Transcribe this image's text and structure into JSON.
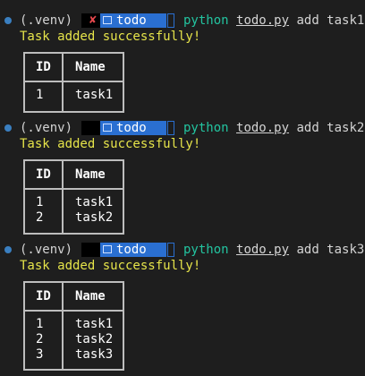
{
  "blocks": [
    {
      "venv": "(.venv)",
      "status_icon": "cross-mark-icon",
      "directory": "todo",
      "command": {
        "keyword": "python",
        "file": "todo.py",
        "args": "add task1"
      },
      "message": "Task added successfully!",
      "table": {
        "headers": [
          "ID",
          "Name"
        ],
        "rows": [
          [
            "1",
            "task1"
          ]
        ]
      }
    },
    {
      "venv": "(.venv)",
      "status_icon": "",
      "directory": "todo",
      "command": {
        "keyword": "python",
        "file": "todo.py",
        "args": "add task2"
      },
      "message": "Task added successfully!",
      "table": {
        "headers": [
          "ID",
          "Name"
        ],
        "rows": [
          [
            "1",
            "task1"
          ],
          [
            "2",
            "task2"
          ]
        ]
      }
    },
    {
      "venv": "(.venv)",
      "status_icon": "",
      "directory": "todo",
      "command": {
        "keyword": "python",
        "file": "todo.py",
        "args": "add task3"
      },
      "message": "Task added successfully!",
      "table": {
        "headers": [
          "ID",
          "Name"
        ],
        "rows": [
          [
            "1",
            "task1"
          ],
          [
            "2",
            "task2"
          ],
          [
            "3",
            "task3"
          ]
        ]
      }
    }
  ],
  "colors": {
    "background": "#1e1e1e",
    "prompt_dot": "#3a7fc0",
    "directory_segment": "#2a6fd1",
    "command_keyword": "#23c4a0",
    "success_message": "#e6e44a",
    "error_mark": "#e5484d",
    "table_border": "#bdbdbd"
  }
}
